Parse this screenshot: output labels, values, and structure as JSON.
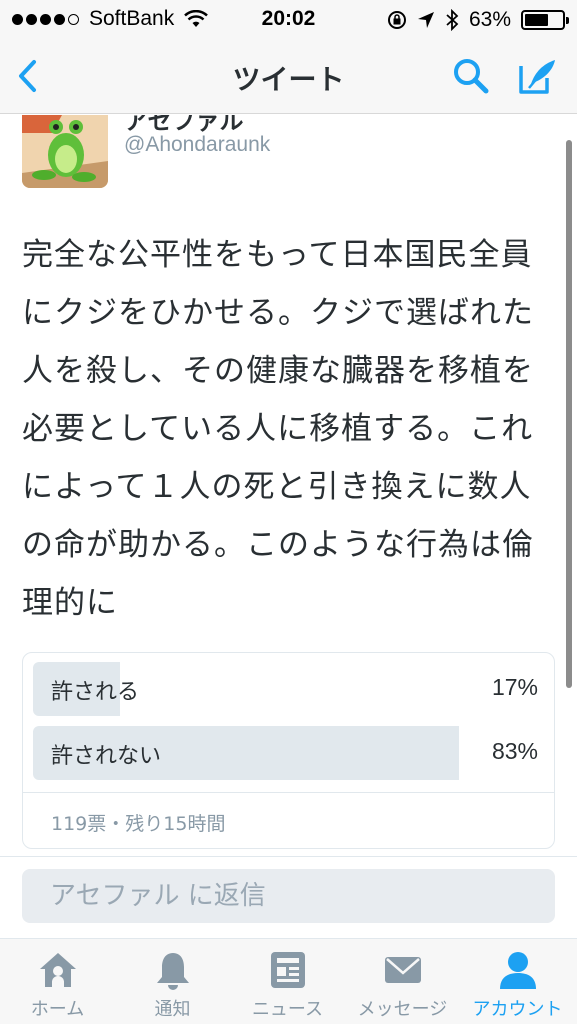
{
  "status": {
    "carrier": "SoftBank",
    "time": "20:02",
    "battery": "63%"
  },
  "nav": {
    "title": "ツイート"
  },
  "author": {
    "name": "アセファル",
    "handle": "@Ahondaraunk"
  },
  "tweet": {
    "text": "完全な公平性をもって日本国民全員にクジをひかせる。クジで選ばれた人を殺し、その健康な臓器を移植を必要としている人に移植する。これによって１人の死と引き換えに数人の命が助かる。このような行為は倫理的に"
  },
  "poll": {
    "options": [
      {
        "label": "許される",
        "percent": "17%",
        "value": 17
      },
      {
        "label": "許されない",
        "percent": "83%",
        "value": 83
      }
    ],
    "meta": "119票・残り15時間"
  },
  "reply": {
    "placeholder": "アセファル に返信"
  },
  "tabs": [
    {
      "label": "ホーム",
      "icon": "home-icon"
    },
    {
      "label": "通知",
      "icon": "bell-icon"
    },
    {
      "label": "ニュース",
      "icon": "news-icon"
    },
    {
      "label": "メッセージ",
      "icon": "envelope-icon"
    },
    {
      "label": "アカウント",
      "icon": "account-icon"
    }
  ],
  "colors": {
    "accent": "#1da1f2",
    "inactive": "#8899a6"
  }
}
